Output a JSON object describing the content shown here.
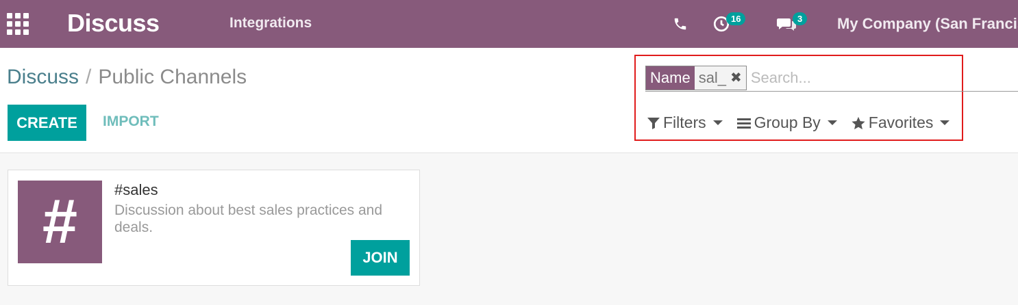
{
  "navbar": {
    "app_name": "Discuss",
    "menu_items": [
      "Integrations"
    ],
    "activity_count": "16",
    "messages_count": "3",
    "company": "My Company (San Francisco)"
  },
  "breadcrumb": {
    "root": "Discuss",
    "separator": "/",
    "current": "Public Channels"
  },
  "buttons": {
    "create": "CREATE",
    "import": "IMPORT"
  },
  "search": {
    "facet_label": "Name",
    "facet_value": "sal_",
    "placeholder": "Search...",
    "filters": "Filters",
    "group_by": "Group By",
    "favorites": "Favorites"
  },
  "channels": [
    {
      "image_symbol": "#",
      "name": "#sales",
      "description": "Discussion about best sales practices and deals.",
      "join_label": "JOIN"
    }
  ],
  "colors": {
    "brand": "#875a7b",
    "primary": "#00a09d",
    "highlight": "#e01b1b"
  }
}
